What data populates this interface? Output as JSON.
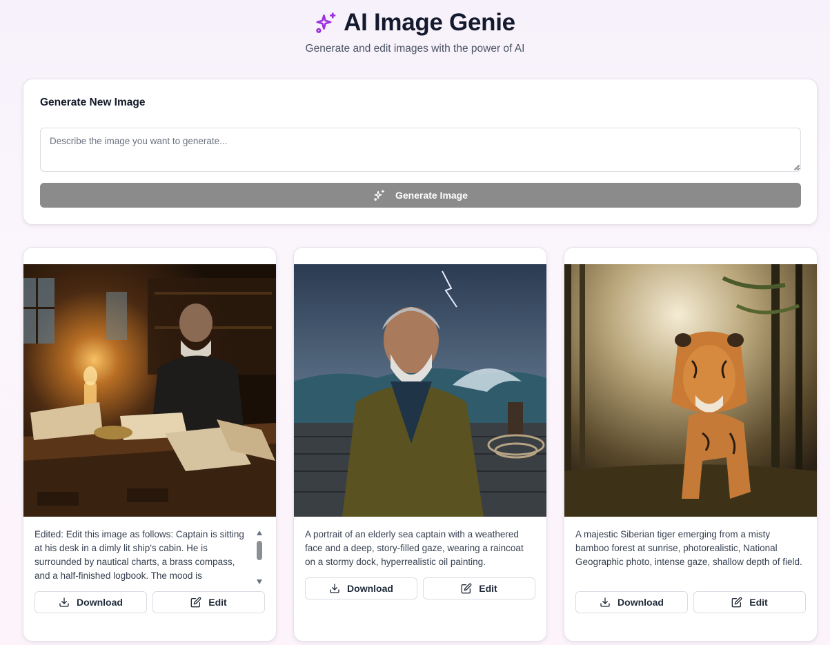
{
  "header": {
    "title": "AI Image Genie",
    "subtitle": "Generate and edit images with the power of AI",
    "icon": "sparkles-icon",
    "accent_color": "#9b30e0"
  },
  "generator": {
    "heading": "Generate New Image",
    "prompt_placeholder": "Describe the image you want to generate...",
    "prompt_value": "",
    "button_label": "Generate Image",
    "button_color": "#8b8b8b"
  },
  "gallery": {
    "cards": [
      {
        "image": "captain-desk-painting",
        "description": "Edited: Edit this image as follows: Captain is sitting at his desk in a dimly lit ship's cabin. He is surrounded by nautical charts, a brass compass, and a half-finished logbook. The mood is",
        "download_label": "Download",
        "edit_label": "Edit"
      },
      {
        "image": "sea-captain-storm-portrait",
        "description": "A portrait of an elderly sea captain with a weathered face and a deep, story-filled gaze, wearing a raincoat on a stormy dock, hyperrealistic oil painting.",
        "download_label": "Download",
        "edit_label": "Edit"
      },
      {
        "image": "siberian-tiger-bamboo",
        "description": "A majestic Siberian tiger emerging from a misty bamboo forest at sunrise, photorealistic, National Geographic photo, intense gaze, shallow depth of field.",
        "download_label": "Download",
        "edit_label": "Edit"
      }
    ]
  }
}
